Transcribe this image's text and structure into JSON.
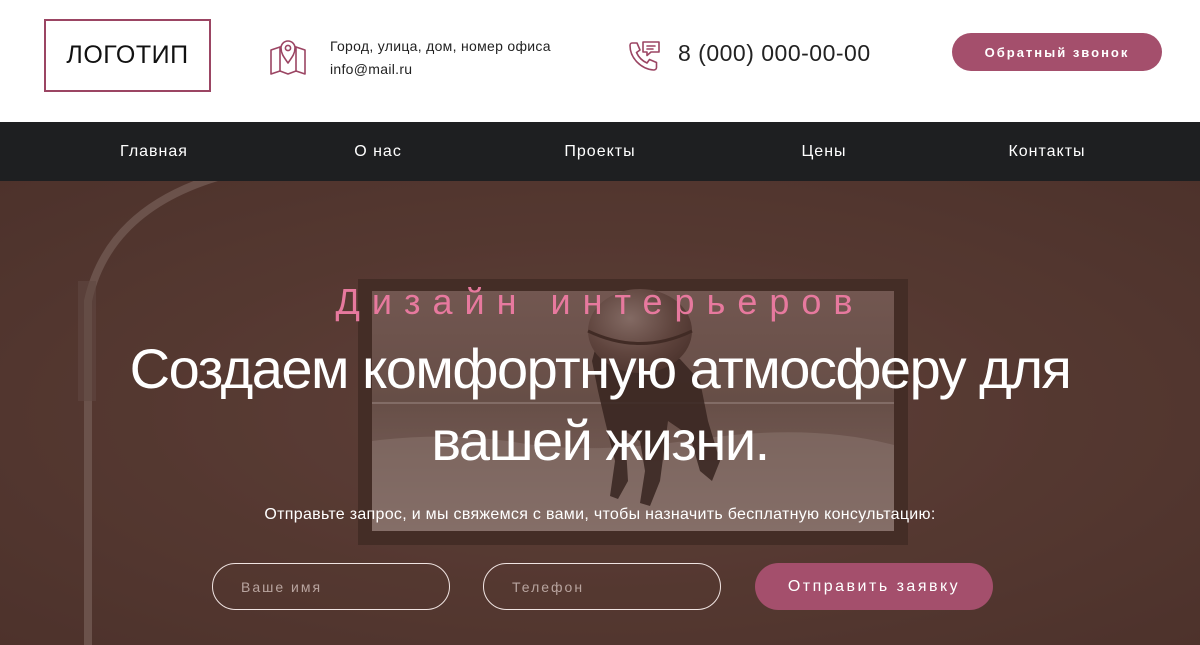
{
  "colors": {
    "accent": "#a44f6c",
    "accent_light": "#e7799e",
    "nav_bg": "#1e1f21",
    "hero_bg": "#5a3c35"
  },
  "header": {
    "logo_text": "ЛОГОТИП",
    "address_icon": "map-pin-icon",
    "address": "Город, улица, дом, номер офиса",
    "email": "info@mail.ru",
    "phone_icon": "phone-chat-icon",
    "phone": "8 (000) 000-00-00",
    "callback_label": "Обратный звонок"
  },
  "nav": {
    "items": [
      {
        "label": "Главная"
      },
      {
        "label": "О нас"
      },
      {
        "label": "Проекты"
      },
      {
        "label": "Цены"
      },
      {
        "label": "Контакты"
      }
    ]
  },
  "hero": {
    "subtitle": "Дизайн интерьеров",
    "title_line1": "Создаем комфортную атмосферу для",
    "title_line2": "вашей жизни.",
    "description": "Отправьте запрос, и мы свяжемся с вами, чтобы назначить бесплатную консультацию:",
    "name_placeholder": "Ваше имя",
    "phone_placeholder": "Телефон",
    "submit_label": "Отправить заявку"
  }
}
